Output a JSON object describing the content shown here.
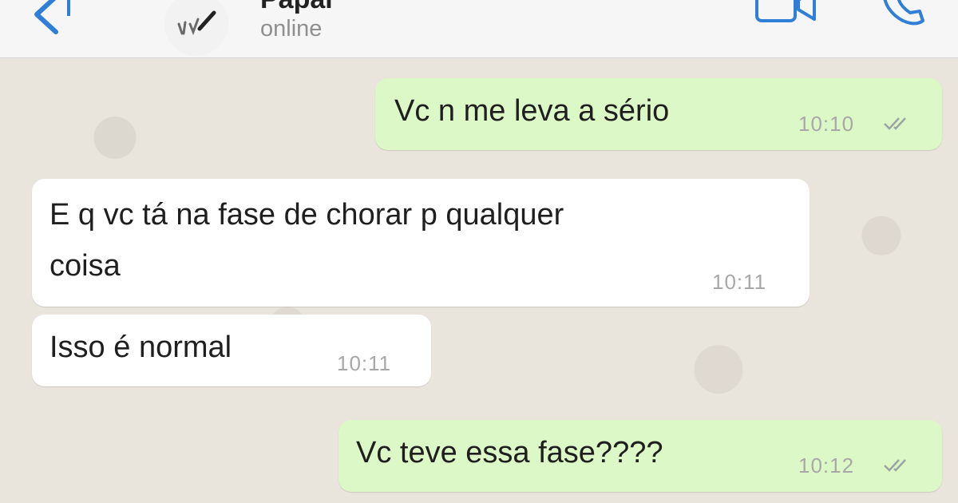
{
  "header": {
    "contact_name": "Papai",
    "status": "online"
  },
  "messages": [
    {
      "direction": "outgoing",
      "text": "Vc n me leva a sério",
      "time": "10:10",
      "read": true
    },
    {
      "direction": "incoming",
      "text_lines": [
        "E q vc tá na fase de chorar p qualquer",
        "coisa"
      ],
      "time": "10:11"
    },
    {
      "direction": "incoming",
      "text": "Isso é normal",
      "time": "10:11"
    },
    {
      "direction": "outgoing",
      "text": "Vc teve essa fase????",
      "time": "10:12",
      "read": true
    }
  ],
  "icons": {
    "back": "chevron-left-icon",
    "video": "video-camera-icon",
    "phone": "phone-icon",
    "read_receipt": "double-check-icon"
  },
  "colors": {
    "outgoing_bubble": "#dcf8c6",
    "incoming_bubble": "#ffffff",
    "accent": "#2f7fd6",
    "chat_background": "#e9e4dc"
  }
}
